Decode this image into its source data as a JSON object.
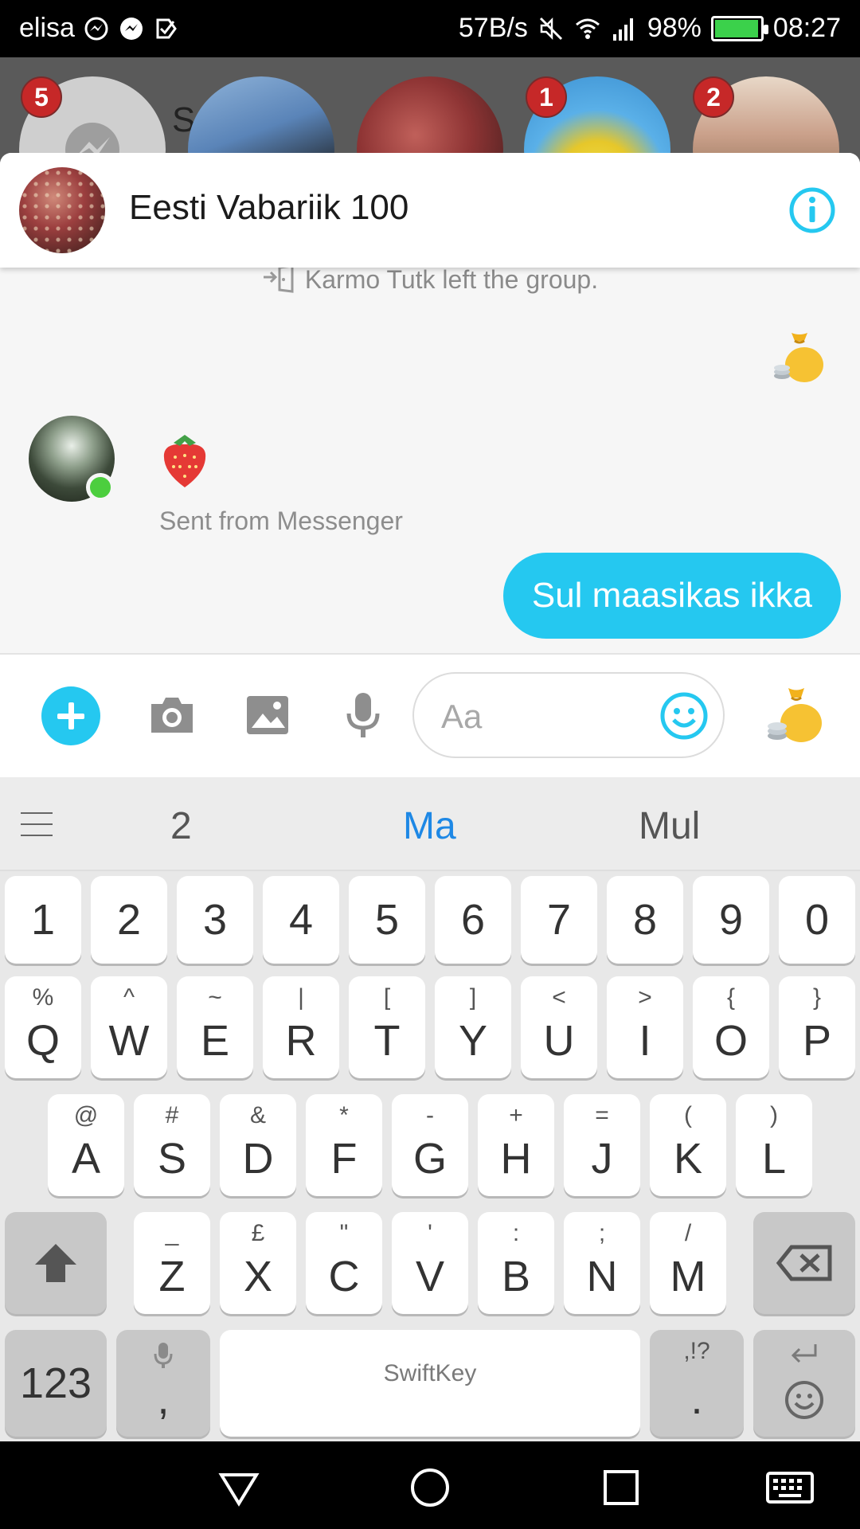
{
  "status_bar": {
    "carrier": "elisa",
    "net_speed": "57B/s",
    "battery": "98%",
    "time": "08:27"
  },
  "chat_heads": {
    "badges": [
      "5",
      "1",
      "2"
    ],
    "partial_letter": "S"
  },
  "chat": {
    "title": "Eesti Vabariik 100",
    "system_message": "Karmo Tutk left the group.",
    "sent_from_label": "Sent from Messenger",
    "outgoing_message": "Sul maasikas ikka"
  },
  "composer": {
    "placeholder": "Aa"
  },
  "keyboard": {
    "suggestions": [
      "2",
      "Ma",
      "Mul"
    ],
    "number_row": [
      "1",
      "2",
      "3",
      "4",
      "5",
      "6",
      "7",
      "8",
      "9",
      "0"
    ],
    "row1": [
      {
        "k": "Q",
        "a": "%"
      },
      {
        "k": "W",
        "a": "^"
      },
      {
        "k": "E",
        "a": "~"
      },
      {
        "k": "R",
        "a": "|"
      },
      {
        "k": "T",
        "a": "["
      },
      {
        "k": "Y",
        "a": "]"
      },
      {
        "k": "U",
        "a": "<"
      },
      {
        "k": "I",
        "a": ">"
      },
      {
        "k": "O",
        "a": "{"
      },
      {
        "k": "P",
        "a": "}"
      }
    ],
    "row2": [
      {
        "k": "A",
        "a": "@"
      },
      {
        "k": "S",
        "a": "#"
      },
      {
        "k": "D",
        "a": "&"
      },
      {
        "k": "F",
        "a": "*"
      },
      {
        "k": "G",
        "a": "-"
      },
      {
        "k": "H",
        "a": "+"
      },
      {
        "k": "J",
        "a": "="
      },
      {
        "k": "K",
        "a": "("
      },
      {
        "k": "L",
        "a": ")"
      }
    ],
    "row3": [
      {
        "k": "Z",
        "a": "_"
      },
      {
        "k": "X",
        "a": "£"
      },
      {
        "k": "C",
        "a": "\""
      },
      {
        "k": "V",
        "a": "'"
      },
      {
        "k": "B",
        "a": ":"
      },
      {
        "k": "N",
        "a": ";"
      },
      {
        "k": "M",
        "a": "/"
      }
    ],
    "key_123": "123",
    "comma_key": ",",
    "space_brand": "SwiftKey",
    "period_alt": ",!?",
    "period_key": "."
  },
  "colors": {
    "accent": "#25c8f0",
    "online": "#4cce3e",
    "badge": "#c62828",
    "suggestion_active": "#1e88e5"
  }
}
